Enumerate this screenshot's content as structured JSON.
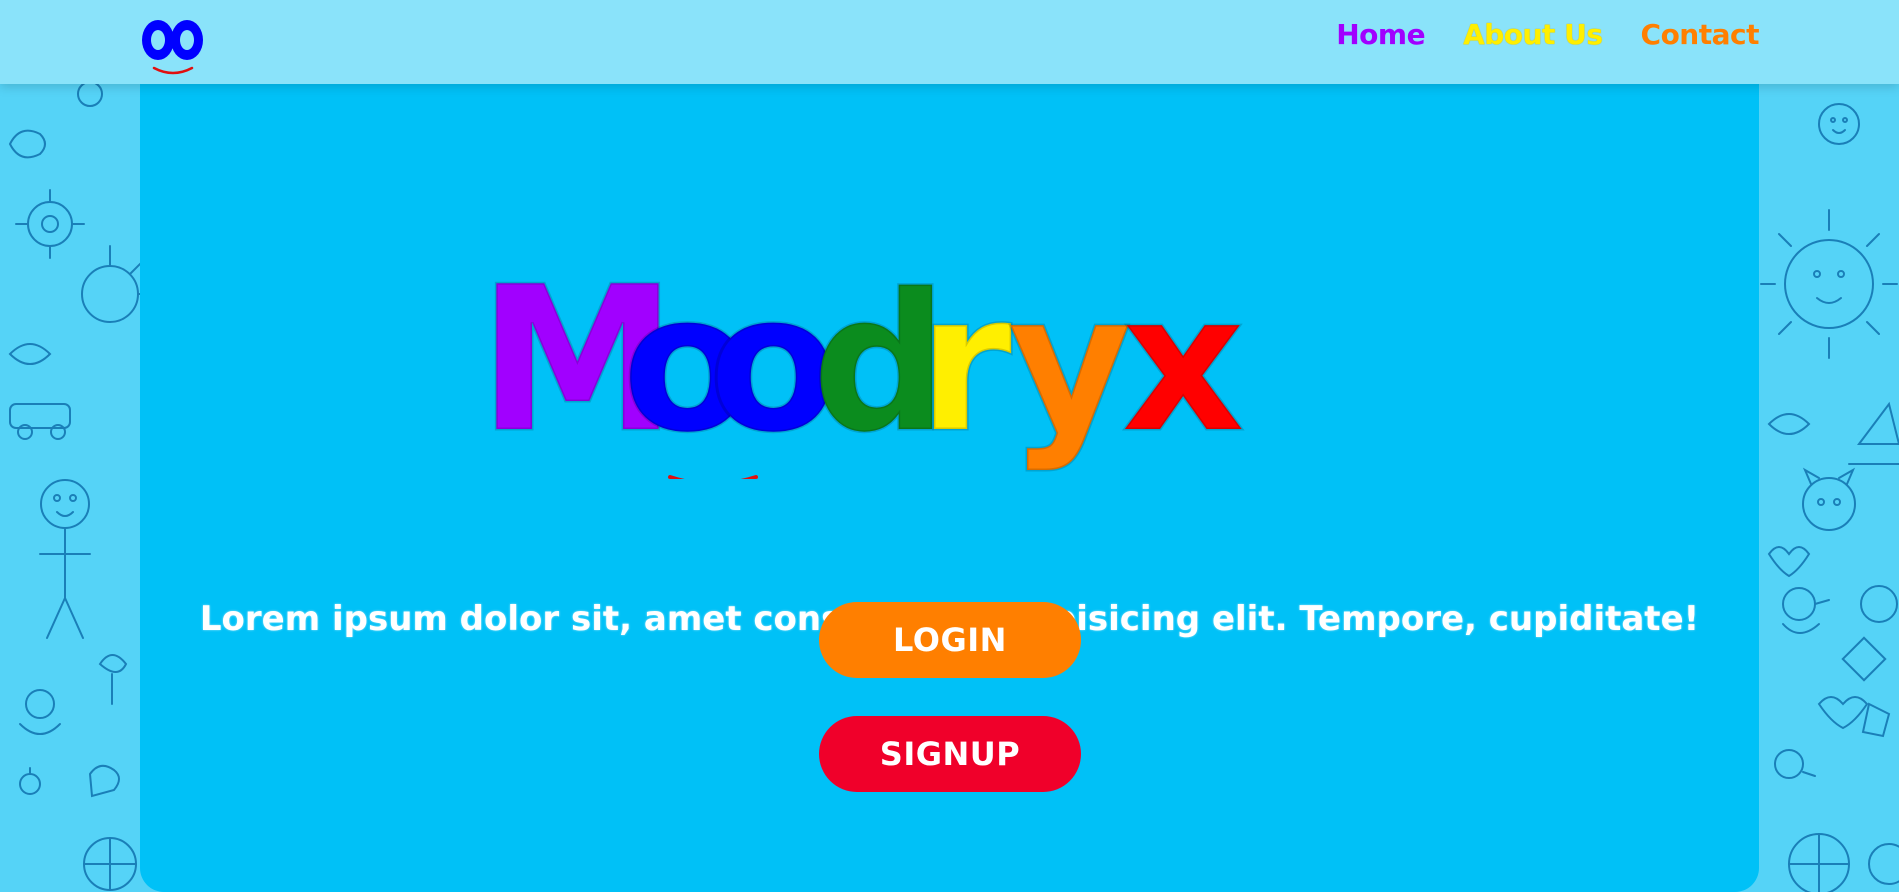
{
  "nav": {
    "links": [
      {
        "label": "Home",
        "color": "#a100ff"
      },
      {
        "label": "About Us",
        "color": "#ffef00"
      },
      {
        "label": "Contact",
        "color": "#ff7f00"
      }
    ]
  },
  "hero": {
    "brand_letters": [
      {
        "char": "M",
        "color": "#a100ff"
      },
      {
        "char": "o",
        "color": "#0000ff"
      },
      {
        "char": "o",
        "color": "#0000ff"
      },
      {
        "char": "d",
        "color": "#0b8c1e"
      },
      {
        "char": "r",
        "color": "#ffef00"
      },
      {
        "char": "y",
        "color": "#ff7f00"
      },
      {
        "char": "x",
        "color": "#ff0000"
      }
    ],
    "tagline": "Lorem ipsum dolor sit, amet consectetur adipisicing elit. Tempore, cupiditate!",
    "login_label": "LOGIN",
    "signup_label": "SIGNUP"
  },
  "colors": {
    "page_bg": "#55d3f7",
    "navbar_bg": "#8ae3fa",
    "panel_bg": "#00c1f7",
    "login_bg": "#ff7f00",
    "signup_bg": "#f0002a"
  }
}
